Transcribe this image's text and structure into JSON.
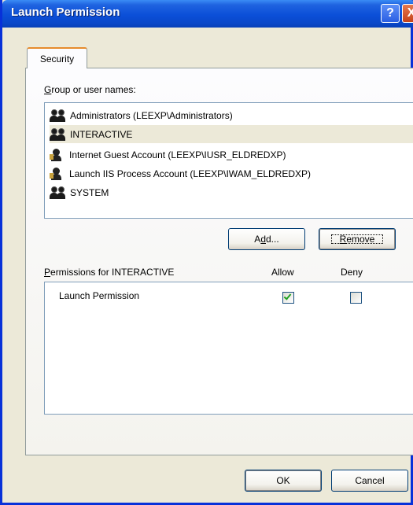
{
  "window": {
    "title": "Launch Permission",
    "help_glyph": "?",
    "close_glyph": "X"
  },
  "tabs": [
    {
      "label": "Security"
    }
  ],
  "group_list": {
    "label_prefix": "G",
    "label_rest": "roup or user names:",
    "items": [
      {
        "label": "Administrators (LEEXP\\Administrators)",
        "icon": "group-icon"
      },
      {
        "label": "INTERACTIVE",
        "icon": "group-icon",
        "selected": true
      },
      {
        "label": "Internet Guest Account (LEEXP\\IUSR_ELDREDXP)",
        "icon": "user-icon"
      },
      {
        "label": "Launch IIS Process Account (LEEXP\\IWAM_ELDREDXP)",
        "icon": "user-icon"
      },
      {
        "label": "SYSTEM",
        "icon": "group-icon"
      }
    ]
  },
  "buttons": {
    "add_a": "A",
    "add_d": "d",
    "add_rest": "d...",
    "remove_r": "R",
    "remove_rest": "emove",
    "ok": "OK",
    "cancel": "Cancel"
  },
  "permissions": {
    "label_prefix": "P",
    "label_rest": "ermissions for INTERACTIVE",
    "allow_header": "Allow",
    "deny_header": "Deny",
    "rows": [
      {
        "name": "Launch Permission",
        "allow": true,
        "deny": false
      }
    ]
  },
  "colors": {
    "titlebar": "#0b4fd8",
    "face": "#ece9d8",
    "selection": "#ece9d8",
    "check": "#21a121"
  }
}
